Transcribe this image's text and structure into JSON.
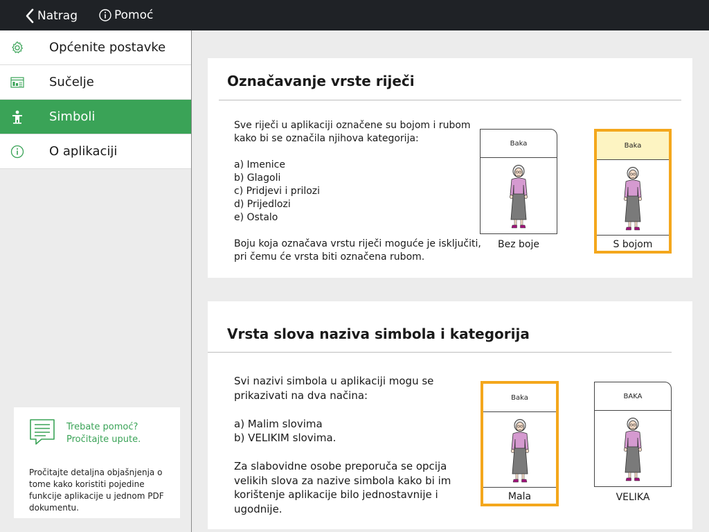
{
  "topbar": {
    "back_label": "Natrag",
    "help_label": "Pomoć"
  },
  "sidebar": {
    "items": [
      {
        "label": "Općenite postavke",
        "icon": "gear-icon"
      },
      {
        "label": "Sučelje",
        "icon": "layout-icon"
      },
      {
        "label": "Simboli",
        "icon": "symbol-figure-icon",
        "active": true
      },
      {
        "label": "O aplikaciji",
        "icon": "info-icon"
      }
    ],
    "help": {
      "title_line1": "Trebate pomoć?",
      "title_line2": "Pročitajte upute.",
      "description": "Pročitajte detaljna objašnjenja o tome kako koristiti pojedine funkcije aplikacije u jednom PDF dokumentu."
    }
  },
  "section1": {
    "title": "Označavanje vrste riječi",
    "text": "Sve riječi u aplikaciji označene su bojom i rubom\nkako bi se označila njihova kategorija:\n\na) Imenice\nb) Glagoli\nc) Pridjevi i prilozi\nd) Prijedlozi\ne) Ostalo\n\nBoju koja označava vrstu riječi moguće je isključiti,\npri čemu će vrsta biti označena rubom.",
    "option1": {
      "symbol_name": "Baka",
      "caption": "Bez boje",
      "selected": false
    },
    "option2": {
      "symbol_name": "Baka",
      "caption": "S bojom",
      "selected": true
    }
  },
  "section2": {
    "title": "Vrsta slova naziva simbola i kategorija",
    "text": "Svi nazivi simbola u aplikaciji mogu se\nprikazivati na dva načina:\n\na) Malim slovima\nb) VELIKIM slovima.\n\nZa slabovidne osobe preporuča se opcija\nvelikih slova za nazive simbola kako bi im\nkorištenje aplikacije bilo jednostavnije i\nugodnije.",
    "option1": {
      "symbol_name": "Baka",
      "caption": "Mala",
      "selected": true
    },
    "option2": {
      "symbol_name": "BAKA",
      "caption": "VELIKA",
      "selected": false
    }
  },
  "colors": {
    "accent_green": "#3aa357",
    "selection_orange": "#f4a71c",
    "topbar_dark": "#1f2226"
  }
}
